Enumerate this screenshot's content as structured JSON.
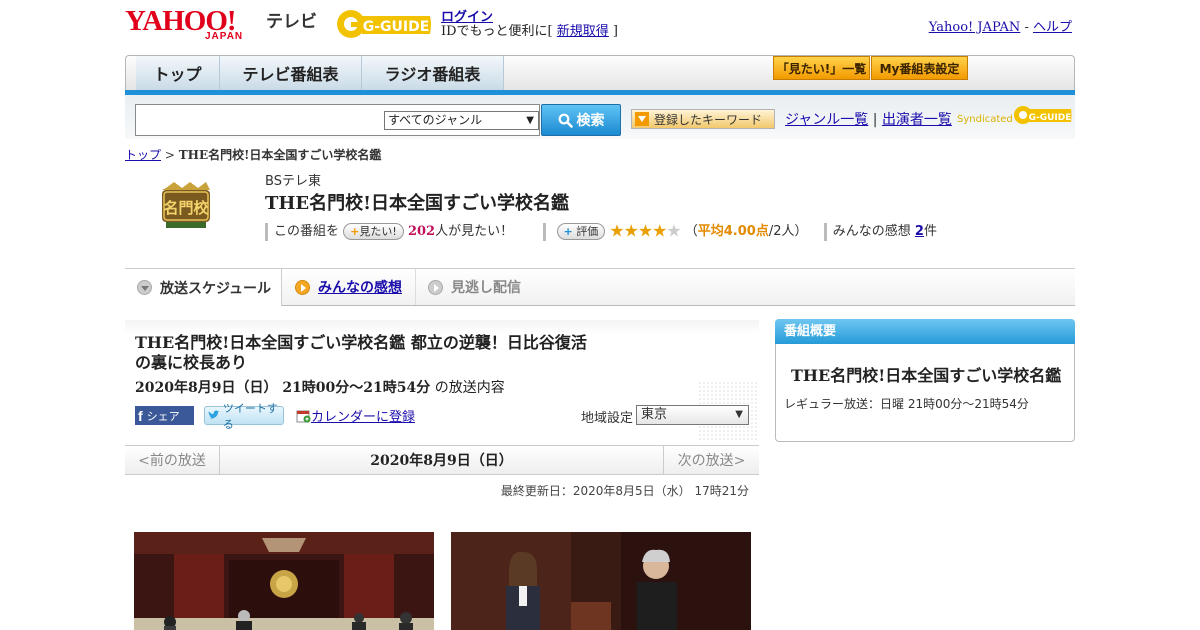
{
  "header": {
    "yahoo_logo": "YAHOO!",
    "yahoo_sub": "JAPAN",
    "tv_label": "テレビ",
    "gguide_logo": "G-GUIDE",
    "login": "ログイン",
    "id_text_pre": "IDでもっと便利に[ ",
    "signup": "新規取得",
    "id_text_post": " ]",
    "yahoo_japan_link": "Yahoo! JAPAN",
    "sep": " - ",
    "help_link": "ヘルプ"
  },
  "nav": {
    "tabs": [
      {
        "label": "トップ"
      },
      {
        "label": "テレビ番組表"
      },
      {
        "label": "ラジオ番組表"
      }
    ],
    "mitai_list": "「見たい!」一覧",
    "my_schedule": "My番組表設定"
  },
  "search": {
    "genre_value": "すべてのジャンル",
    "search_btn": "検索",
    "keyword_btn": "登録したキーワード",
    "genre_list": "ジャンル一覧",
    "divider": "|",
    "cast_list": "出演者一覧",
    "syndicated": "Syndicated"
  },
  "breadcrumb": {
    "home": "トップ",
    "sep": " > ",
    "current": "THE名門校!日本全国すごい学校名鑑"
  },
  "program": {
    "logo_text": "名門校",
    "channel": "BSテレ東",
    "title": "THE名門校!日本全国すごい学校名鑑",
    "pre_mitai": "この番組を",
    "mitai_btn": "見たい!",
    "mitai_count": "202",
    "mitai_post": "人が見たい！",
    "rating_btn": "評価",
    "stars_on": "★★★★",
    "stars_off": "★",
    "avg_open": "（",
    "avg_label": "平均4.00点",
    "avg_people": "/2人）",
    "comments_label": "みんなの感想",
    "comments_count": "2",
    "comments_unit": "件",
    "rating_value": 4.0
  },
  "tabs": {
    "schedule": "放送スケジュール",
    "impressions": "みんなの感想",
    "missed": "見逃し配信"
  },
  "episode": {
    "title": "THE名門校!日本全国すごい学校名鑑 都立の逆襲！日比谷復活の裏に校長あり",
    "date": "2020年8月9日（日） 21時00分～21時54分",
    "date_suffix": " の放送内容",
    "fb_share": "シェア",
    "tweet": "ツイートする",
    "calendar": "カレンダーに登録",
    "region_label": "地域設定",
    "region_value": "東京"
  },
  "pager": {
    "prev": "<前の放送",
    "current": "2020年8月9日（日）",
    "next": "次の放送>"
  },
  "updated": "最終更新日：2020年8月5日（水） 17時21分",
  "sidebar": {
    "heading": "番組概要",
    "title": "THE名門校!日本全国すごい学校名鑑",
    "regular": "レギュラー放送：日曜 21時00分～21時54分"
  }
}
